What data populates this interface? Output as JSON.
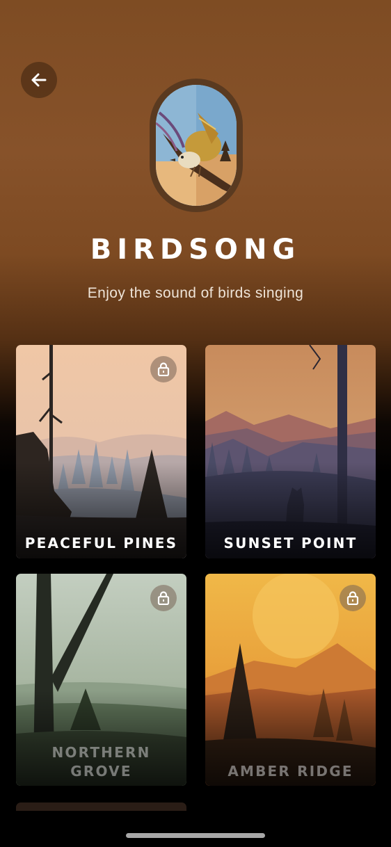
{
  "header": {
    "back_icon": "arrow-left-icon",
    "hero_icon": "bird-illustration",
    "title": "BIRDSONG",
    "subtitle": "Enjoy the sound of birds singing"
  },
  "cards": [
    {
      "label": "PEACEFUL PINES",
      "locked": true,
      "icon": "lock-icon"
    },
    {
      "label": "SUNSET POINT",
      "locked": false
    },
    {
      "label_line1": "NORTHERN",
      "label_line2": "GROVE",
      "locked": true,
      "icon": "lock-icon"
    },
    {
      "label": "AMBER RIDGE",
      "locked": true,
      "icon": "lock-icon"
    }
  ],
  "colors": {
    "background_top": "#7e4c23",
    "background_bottom": "#000000",
    "title": "#ffffff"
  }
}
